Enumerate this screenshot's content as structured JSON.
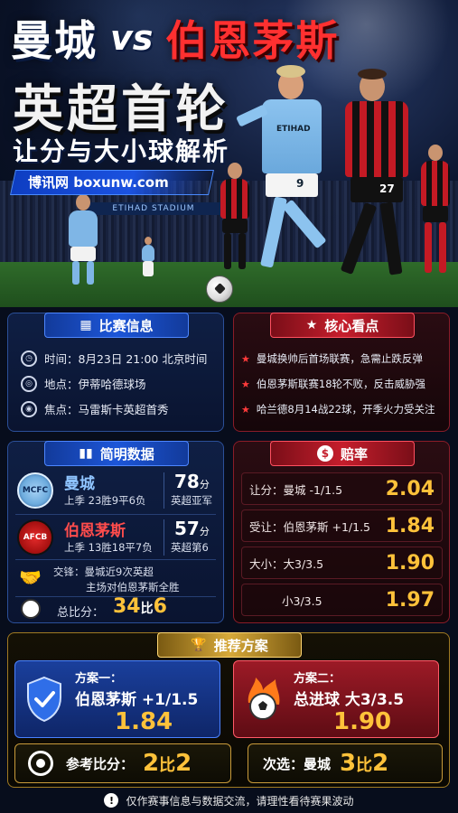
{
  "header": {
    "home_team": "曼城",
    "vs": "vs",
    "away_team": "伯恩茅斯",
    "league": "英超首轮",
    "subtitle": "让分与大小球解析",
    "site": "博讯网 boxunw.com",
    "stadium_banner": "ETIHAD STADIUM"
  },
  "match_info": {
    "title": "比赛信息",
    "time_label": "时间：",
    "time_value": "8月23日 21:00 北京时间",
    "venue_label": "地点：",
    "venue_value": "伊蒂哈德球场",
    "focus_label": "焦点：",
    "focus_value": "马雷斯卡英超首秀"
  },
  "highlights": {
    "title": "核心看点",
    "items": [
      "曼城换帅后首场联赛，急需止跌反弹",
      "伯恩茅斯联赛18轮不败，反击威胁强",
      "哈兰德8月14战22球，开季火力受关注"
    ]
  },
  "stats": {
    "title": "简明数据",
    "home": {
      "crest": "MANCHESTER CITY",
      "name": "曼城",
      "record": "上季 23胜9平6负",
      "points": "78",
      "points_unit": "分",
      "rank": "英超亚军"
    },
    "away": {
      "crest": "AFCB",
      "name": "伯恩茅斯",
      "record": "上季 13胜18平7负",
      "points": "57",
      "points_unit": "分",
      "rank": "英超第6"
    },
    "h2h_line1": "交锋：曼城近9次英超",
    "h2h_line2": "主场对伯恩茅斯全胜",
    "total_label": "总比分：",
    "total_home": "34",
    "total_sep": "比",
    "total_away": "6"
  },
  "odds": {
    "title": "赔率",
    "rows": [
      {
        "label": "让分：曼城 -1/1.5",
        "value": "2.04"
      },
      {
        "label": "受让：伯恩茅斯 +1/1.5",
        "value": "1.84"
      },
      {
        "label": "大小：大3/3.5",
        "value": "1.90"
      },
      {
        "label": "小3/3.5",
        "value": "1.97"
      }
    ]
  },
  "recommend": {
    "title": "推荐方案",
    "plan1": {
      "title": "方案一：",
      "text": "伯恩茅斯 +1/1.5",
      "odds": "1.84"
    },
    "plan2": {
      "title": "方案二：",
      "text": "总进球 大3/3.5",
      "odds": "1.90"
    },
    "ref_label": "参考比分：",
    "ref_home": "2",
    "ref_sep": "比",
    "ref_away": "2",
    "alt_label": "次选：曼城",
    "alt_home": "3",
    "alt_sep": "比",
    "alt_away": "2"
  },
  "footer": {
    "text": "仅作赛事信息与数据交流，请理性看待赛果波动"
  },
  "colors": {
    "accent_blue": "#1d56d8",
    "accent_red": "#c51e2c",
    "gold": "#ffc23a"
  }
}
